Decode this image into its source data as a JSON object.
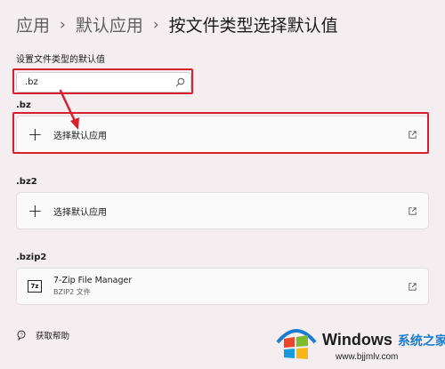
{
  "breadcrumb": {
    "items": [
      "应用",
      "默认应用",
      "按文件类型选择默认值"
    ],
    "separator": "›"
  },
  "section_label": "设置文件类型的默认值",
  "search": {
    "value": ".bz",
    "placeholder": "",
    "icon": "search-icon"
  },
  "groups": [
    {
      "label": ".bz",
      "action_label": "选择默认应用",
      "icon": "plus-icon",
      "link_icon": "open-external-icon"
    },
    {
      "label": ".bz2",
      "action_label": "选择默认应用",
      "icon": "plus-icon",
      "link_icon": "open-external-icon"
    },
    {
      "label": ".bzip2",
      "app_name": "7-Zip File Manager",
      "app_sub": "BZIP2 文件",
      "app_icon_text": "7z",
      "icon": "7zip-icon",
      "link_icon": "open-external-icon"
    }
  ],
  "help": {
    "label": "获取帮助",
    "icon": "help-icon"
  },
  "watermark": {
    "brand": "Windows",
    "brand_suffix": "系统之家",
    "url": "www.bjjmlv.com"
  },
  "colors": {
    "highlight": "#d8202c",
    "background": "#f4eef0",
    "card": "#fbfafb",
    "accent": "#1a7ccf"
  }
}
